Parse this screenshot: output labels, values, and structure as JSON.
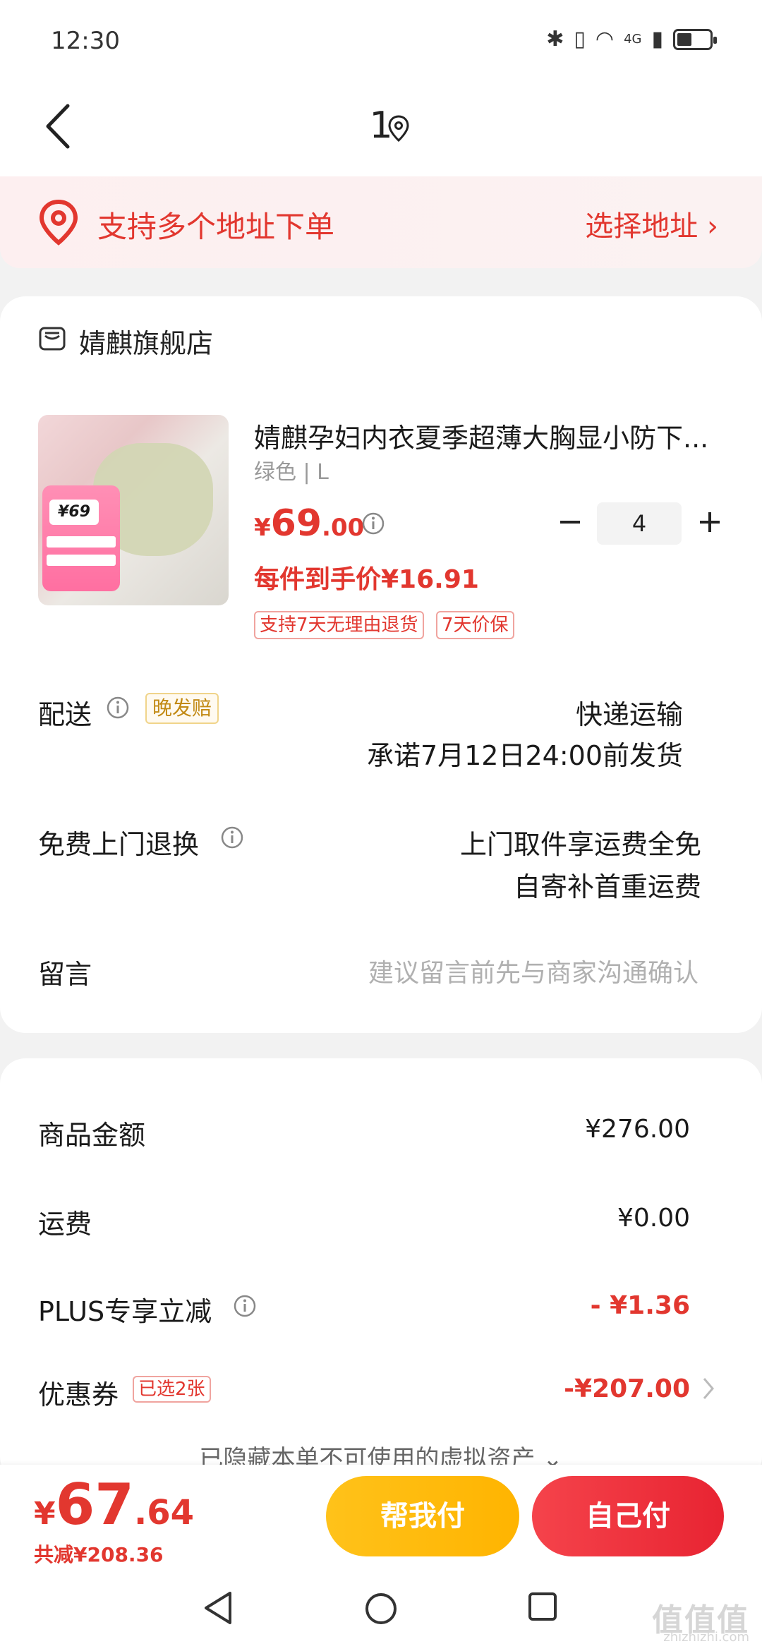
{
  "status_bar": {
    "time": "12:30",
    "network": "4G"
  },
  "header": {
    "title": "1"
  },
  "address_banner": {
    "text": "支持多个地址下单",
    "action": "选择地址 ›"
  },
  "shop": {
    "name": "婧麒旗舰店"
  },
  "product": {
    "title": "婧麒孕妇内衣夏季超薄大胸显小防下...",
    "spec": "绿色 | L",
    "price_symbol": "¥",
    "price_int": "69",
    "price_dec": ".00",
    "quantity": "4",
    "unit_price": "每件到手价¥16.91",
    "tags": [
      "支持7天无理由退货",
      "7天价保"
    ],
    "image_text": {
      "price": "¥69"
    }
  },
  "delivery": {
    "label": "配送",
    "badge": "晚发赔",
    "method": "快递运输",
    "promise": "承诺7月12日24:00前发货"
  },
  "returns": {
    "label": "免费上门退换",
    "line1": "上门取件享运费全免",
    "line2": "自寄补首重运费"
  },
  "note": {
    "label": "留言",
    "placeholder": "建议留言前先与商家沟通确认"
  },
  "summary": {
    "goods_label": "商品金额",
    "goods_value": "¥276.00",
    "shipping_label": "运费",
    "shipping_value": "¥0.00",
    "plus_label": "PLUS专享立减",
    "plus_value": "- ¥1.36",
    "coupon_label": "优惠券",
    "coupon_badge": "已选2张",
    "coupon_value": "-¥207.00",
    "hidden_assets": "已隐藏本单不可使用的虚拟资产 ⌄"
  },
  "footer": {
    "total_symbol": "¥",
    "total_int": "67",
    "total_dec": ".64",
    "saved": "共减¥208.36",
    "pay_friend": "帮我付",
    "pay_self": "自己付"
  },
  "watermark": {
    "text": "值值值",
    "sub": "zhizhizhi.com"
  },
  "colors": {
    "accent": "#e2372f",
    "friend_button": "#ffbb14",
    "self_button": "#ec2d38"
  }
}
